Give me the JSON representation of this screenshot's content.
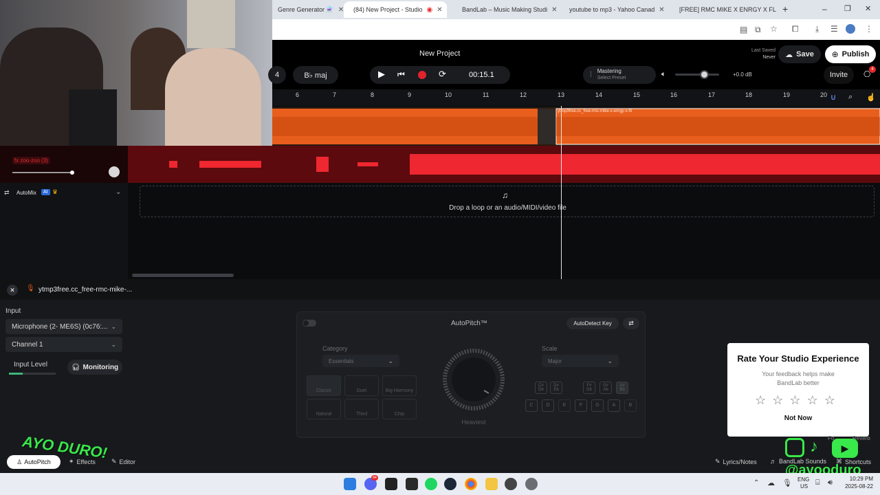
{
  "browser": {
    "tabs": [
      {
        "title": "Genre Generator ⚗️",
        "color": "#8aa4d8",
        "active": false
      },
      {
        "title": "(84) New Project - Studio",
        "color": "#e52a2a",
        "active": true
      },
      {
        "title": "BandLab – Music Making Studi",
        "color": "#0aa08c",
        "active": false
      },
      {
        "title": "youtube to mp3 - Yahoo Canad",
        "color": "#6b1fb1",
        "active": false
      },
      {
        "title": "[FREE] RMC MIKE X ENRGY X FL",
        "color": "#e88a64",
        "active": false
      }
    ],
    "new_tab": "+",
    "win_min": "–",
    "win_max": "❐",
    "win_close": "✕"
  },
  "header": {
    "project_name": "New Project",
    "last_saved_label": "Last Saved",
    "last_saved_value": "Never",
    "save_label": "Save",
    "publish_label": "Publish",
    "bpm_value": "4",
    "key_value": "B♭ maj",
    "time": "00:15.1",
    "mastering_title": "Mastering",
    "mastering_sub": "Select Preset",
    "volume_db": "+0.0 dB",
    "invite_label": "Invite",
    "notif_count": "4"
  },
  "ruler": {
    "ticks": [
      "6",
      "7",
      "8",
      "9",
      "10",
      "11",
      "12",
      "13",
      "14",
      "15",
      "16",
      "17",
      "18",
      "19",
      "20"
    ]
  },
  "tracks": {
    "clip1_name": "ytmp3free.cc_free-rmc-mike-x-enrgy-x-fli",
    "track2_fx": "fx zoo-zoo (3)",
    "automix_label": "AutoMix",
    "automix_ai": "AI",
    "drop_text": "Drop a loop or an audio/MIDI/video file"
  },
  "editor": {
    "track_title": "ytmp3free.cc_free-rmc-mike-...",
    "input_label": "Input",
    "input_device": "Microphone (2- ME6S) (0c76:...",
    "channel": "Channel 1",
    "input_level_label": "Input Level",
    "monitoring_label": "Monitoring",
    "input_level": 0.3
  },
  "autopitch": {
    "title": "AutoPitch™",
    "autodetect_label": "AutoDetect Key",
    "category_label": "Category",
    "category_value": "Essentials",
    "scale_label": "Scale",
    "scale_value": "Major",
    "knob_label": "Heaviest",
    "presets": [
      "Classic",
      "Duet",
      "Big Harmony",
      "Natural",
      "Third",
      "Chip"
    ],
    "accidentals": [
      "C#\nDb",
      "D#\nEb",
      "F#\nGb",
      "G#\nAb",
      "A#\nBb"
    ],
    "naturals": [
      "C",
      "D",
      "E",
      "F",
      "G",
      "A",
      "B"
    ]
  },
  "rate_card": {
    "title": "Rate Your Studio Experience",
    "subtitle": "Your feedback helps make BandLab better",
    "stars": [
      "☆",
      "☆",
      "☆",
      "☆",
      "☆"
    ],
    "not_now": "Not Now"
  },
  "bottom_bar": {
    "autopitch_tab": "AutoPitch",
    "effects_tab": "Effects",
    "editor_tab": "Editor",
    "lyrics_label": "Lyrics/Notes",
    "sounds_label": "BandLab Sounds",
    "shortcuts_label": "Shortcuts",
    "reverb_label": "Reverb",
    "fore_label": "Fo"
  },
  "overlay": {
    "handle": "@ayooduro",
    "graffiti": "AYO DURO!"
  },
  "taskbar": {
    "lang": "ENG",
    "region": "US",
    "time": "10:29 PM",
    "date": "2025-08-22",
    "discord_badge": "84"
  }
}
